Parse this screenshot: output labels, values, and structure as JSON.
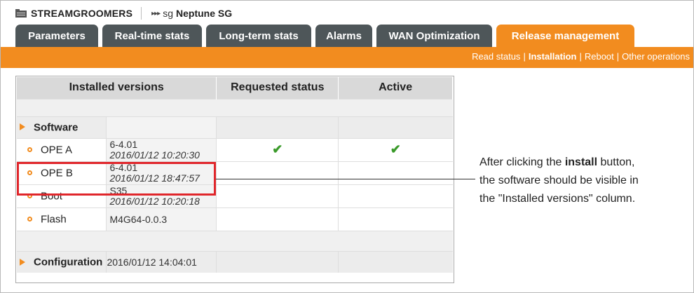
{
  "breadcrumb": {
    "app_name": "STREAMGROOMERS",
    "arrows": "▸▸▸",
    "sg_prefix": "sg",
    "sg_name": "Neptune SG"
  },
  "tabs": [
    {
      "label": "Parameters",
      "active": false
    },
    {
      "label": "Real-time stats",
      "active": false
    },
    {
      "label": "Long-term stats",
      "active": false
    },
    {
      "label": "Alarms",
      "active": false
    },
    {
      "label": "WAN Optimization",
      "active": false
    },
    {
      "label": "Release management",
      "active": true
    }
  ],
  "submenu": {
    "read_status": "Read status",
    "installation": "Installation",
    "reboot": "Reboot",
    "other_operations": "Other operations",
    "separator": "|"
  },
  "table": {
    "headers": {
      "installed": "Installed versions",
      "requested": "Requested status",
      "active": "Active"
    },
    "software_section": "Software",
    "items": [
      {
        "name": "OPE A",
        "version": "6-4.01",
        "timestamp": "2016/01/12 10:20:30",
        "requested_check": "✔",
        "active_check": "✔"
      },
      {
        "name": "OPE B",
        "version": "6-4.01",
        "timestamp": "2016/01/12 18:47:57",
        "requested_check": "",
        "active_check": ""
      },
      {
        "name": "Boot",
        "version": "S35",
        "timestamp": "2016/01/12 10:20:18",
        "requested_check": "",
        "active_check": ""
      },
      {
        "name": "Flash",
        "version": "M4G64-0.0.3",
        "timestamp": "",
        "requested_check": "",
        "active_check": ""
      }
    ],
    "configuration_section": "Configuration",
    "configuration_value": "2016/01/12 14:04:01"
  },
  "annotation": {
    "line1_prefix": "After clicking the ",
    "line1_bold": "install",
    "line1_suffix": " button,",
    "line2": "the software should be visible in",
    "line3": "the \"Installed versions\" column."
  },
  "colors": {
    "accent": "#f28c1f",
    "tab_inactive": "#4e5659",
    "highlight": "#e0262b",
    "check": "#3a9a2a"
  }
}
